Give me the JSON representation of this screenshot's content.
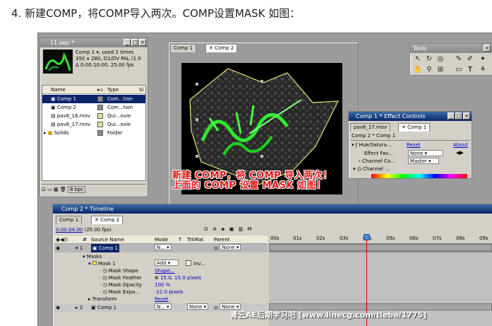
{
  "caption": "4. 新建COMP，将COMP导入两次。COMP设置MASK 如图：",
  "project": {
    "title": "11.aep *",
    "comp_name": "Comp 1",
    "used": "used 2 times",
    "size_line": "350 x 280, D1/DV PAL (1.0",
    "duration_line": "Δ 0:00:10:00, 25.00 fps",
    "col_name": "Name",
    "col_type": "Type",
    "col_size": "Si",
    "items": [
      {
        "name": "Comp 1",
        "type": "Com...tion",
        "color": "#8c8c8c"
      },
      {
        "name": "Comp 2",
        "type": "Com...tion",
        "color": "#8c8c8c"
      },
      {
        "name": "pav6_16.mov",
        "type": "Qui...ovie",
        "color": "#e8e0a0"
      },
      {
        "name": "pav6_17.mov",
        "type": "Qui...ovie",
        "color": "#e8e0a0"
      },
      {
        "name": "Solids",
        "type": "Folder",
        "color": "#8c8c8c"
      }
    ],
    "bpc": "8 bpc"
  },
  "comp_window": {
    "tab1": "Comp 1",
    "tab2": "Comp 2"
  },
  "tools": {
    "title": "Tools"
  },
  "effect_controls": {
    "title": "Comp 1 * Effect Controls",
    "tab_file": "pav6_17.mov",
    "tab_comp": "Comp 1",
    "path": "Comp 2 * Comp 1",
    "effect_name": "Hue/Satura...",
    "reset": "Reset",
    "about": "About",
    "rows": [
      {
        "label": "Effect Fav...",
        "value": "None"
      },
      {
        "label": "Channel Co...",
        "value": "Master"
      },
      {
        "label": "Channel ...",
        "value": ""
      }
    ]
  },
  "overlay": {
    "line1": "新建 COMP，将 COMP 导入两次！",
    "line2": "上面的 COMP 设置 MASK 如图！"
  },
  "timeline": {
    "title": "Comp 2 * Timeline",
    "tab1": "Comp 1",
    "tab2": "Comp 2",
    "timecode": "0:00:04:00",
    "fps": "(25.00 fps)",
    "headers": {
      "num": "#",
      "source": "Source Name",
      "mode": "Mode",
      "t": "T",
      "trkmat": "TrkMat",
      "parent": "Parent"
    },
    "ticks": [
      "00s",
      "01s",
      "02s",
      "03s",
      "04s",
      "05s",
      "06s",
      "07s",
      "08s",
      "09s"
    ],
    "layer1": {
      "num": "1",
      "name": "Comp 1",
      "mode": "N...",
      "parent": "None"
    },
    "masks_label": "Masks",
    "mask1": {
      "name": "Mask 1",
      "mode": "Add",
      "inv": "Inv..."
    },
    "mask_props": [
      {
        "name": "Mask Shape",
        "value": "Shape..."
      },
      {
        "name": "Mask Feather",
        "value": "15.0, 15.0 pixels"
      },
      {
        "name": "Mask Opacity",
        "value": "100 %"
      },
      {
        "name": "Mask Expa...",
        "value": "-12.0 pixels"
      }
    ],
    "transform": {
      "name": "Transform",
      "value": "Reset"
    },
    "layer2": {
      "num": "2",
      "name": "Comp 1",
      "mode": "N...",
      "trkmat": "None",
      "parent": "None"
    }
  },
  "watermark": "青云AE后期学习吧 [www.linecg.com/tieba/1775]"
}
